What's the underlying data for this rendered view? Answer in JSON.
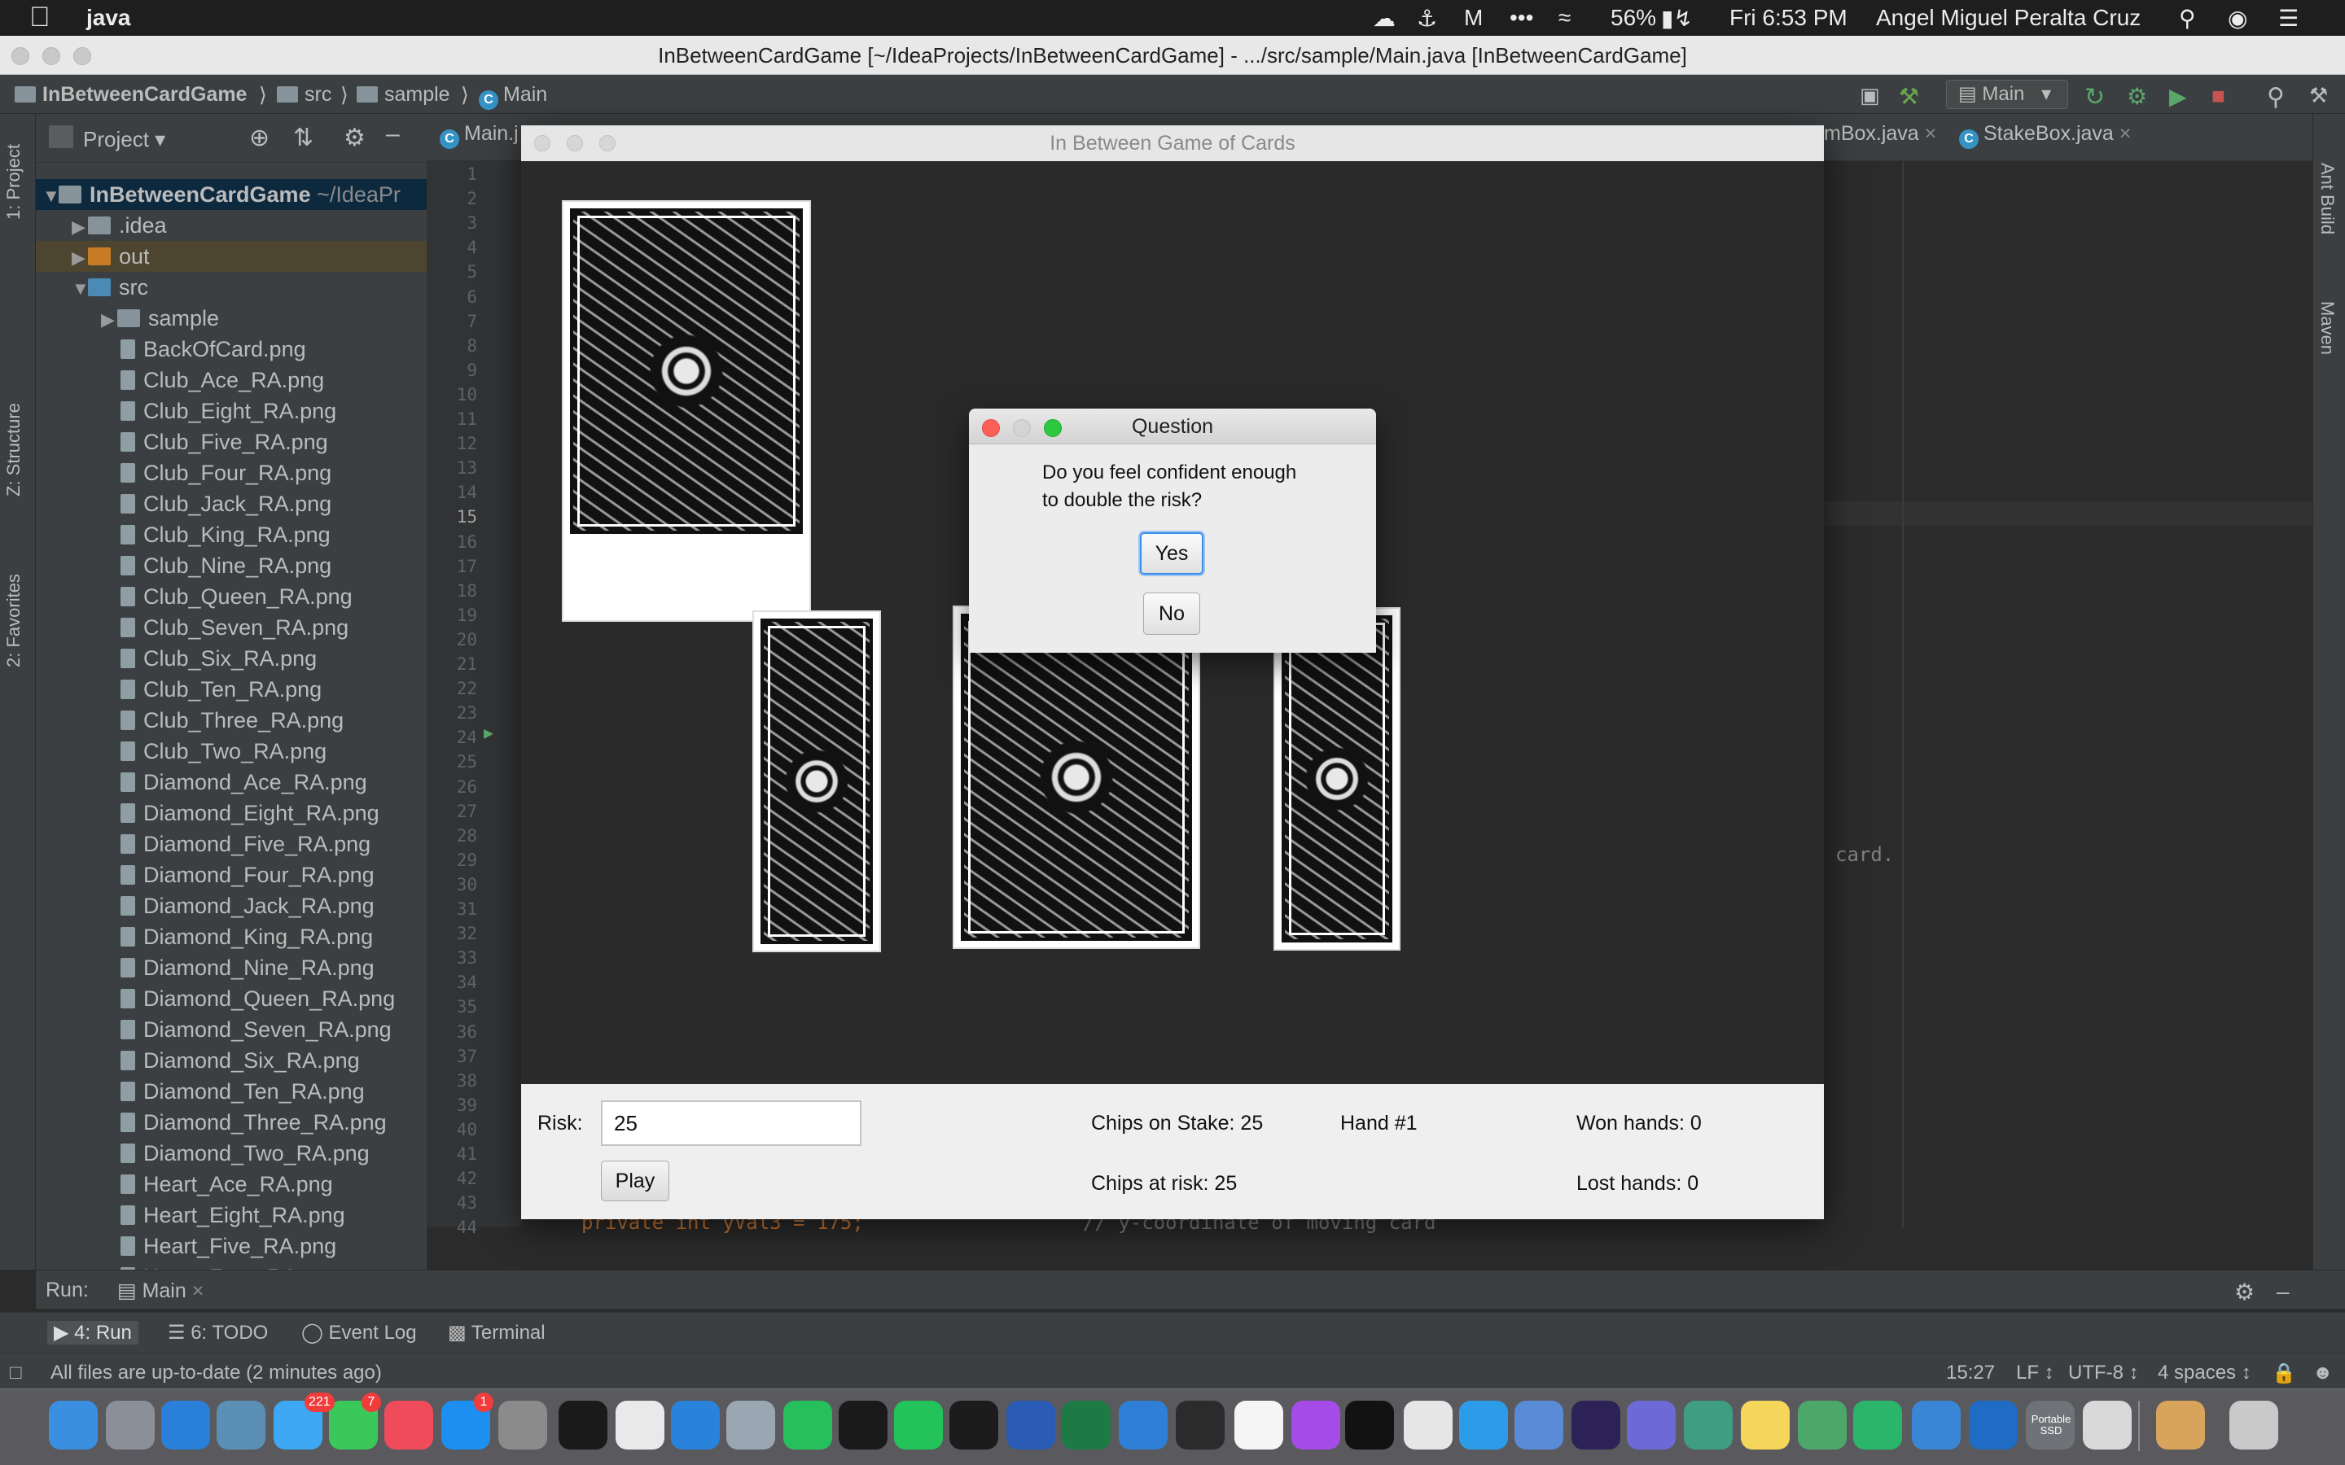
{
  "menubar": {
    "app_name": "java",
    "battery": "56%",
    "clock": "Fri 6:53 PM",
    "user": "Angel Miguel Peralta Cruz"
  },
  "window": {
    "title": "InBetweenCardGame [~/IdeaProjects/InBetweenCardGame] - .../src/sample/Main.java [InBetweenCardGame]"
  },
  "breadcrumb": {
    "project": "InBetweenCardGame",
    "src": "src",
    "package": "sample",
    "class": "Main",
    "run_config": "Main"
  },
  "sidebar": {
    "project_tab": "1: Project",
    "structure_tab": "Z: Structure",
    "favorites_tab": "2: Favorites",
    "ant_tab": "Ant Build",
    "maven_tab": "Maven"
  },
  "project_panel": {
    "title": "Project",
    "root": "InBetweenCardGame",
    "root_path": "~/IdeaPr",
    "folders": [
      ".idea",
      "out",
      "src",
      "sample"
    ],
    "files": [
      "BackOfCard.png",
      "Club_Ace_RA.png",
      "Club_Eight_RA.png",
      "Club_Five_RA.png",
      "Club_Four_RA.png",
      "Club_Jack_RA.png",
      "Club_King_RA.png",
      "Club_Nine_RA.png",
      "Club_Queen_RA.png",
      "Club_Seven_RA.png",
      "Club_Six_RA.png",
      "Club_Ten_RA.png",
      "Club_Three_RA.png",
      "Club_Two_RA.png",
      "Diamond_Ace_RA.png",
      "Diamond_Eight_RA.png",
      "Diamond_Five_RA.png",
      "Diamond_Four_RA.png",
      "Diamond_Jack_RA.png",
      "Diamond_King_RA.png",
      "Diamond_Nine_RA.png",
      "Diamond_Queen_RA.png",
      "Diamond_Seven_RA.png",
      "Diamond_Six_RA.png",
      "Diamond_Ten_RA.png",
      "Diamond_Three_RA.png",
      "Diamond_Two_RA.png",
      "Heart_Ace_RA.png",
      "Heart_Eight_RA.png",
      "Heart_Five_RA.png",
      "Heart_Four_RA.png"
    ]
  },
  "editor": {
    "tabs": [
      "Main.j",
      "mBox.java",
      "StakeBox.java"
    ],
    "line_numbers": [
      "1",
      "2",
      "3",
      "4",
      "5",
      "6",
      "7",
      "8",
      "9",
      "10",
      "11",
      "12",
      "13",
      "14",
      "15",
      "16",
      "17",
      "18",
      "19",
      "20",
      "21",
      "22",
      "23",
      "24",
      "25",
      "26",
      "27",
      "28",
      "29",
      "30",
      "31",
      "32",
      "33",
      "34",
      "35",
      "36",
      "37",
      "38",
      "39",
      "40",
      "41",
      "42",
      "43",
      "44"
    ],
    "code_fragment_1": "card.",
    "code_fragment_2": "private int yVal3 = 175;",
    "code_fragment_3": "// y-coordinate of moving card"
  },
  "game": {
    "title": "In Between Game of Cards",
    "risk_label": "Risk:",
    "risk_value": "25",
    "play_label": "Play",
    "chips_on_stake": "Chips on Stake: 25",
    "chips_at_risk": "Chips at risk: 25",
    "hand": "Hand #1",
    "won_hands": "Won hands: 0",
    "lost_hands": "Lost hands: 0"
  },
  "dialog": {
    "title": "Question",
    "line1": "Do you feel confident enough",
    "line2": "to double the risk?",
    "yes_label": "Yes",
    "no_label": "No"
  },
  "run_panel": {
    "label": "Run:",
    "tab": "Main"
  },
  "tool_buttons": {
    "run": "4: Run",
    "todo": "6: TODO",
    "event_log": "Event Log",
    "terminal": "Terminal"
  },
  "status": {
    "message": "All files are up-to-date (2 minutes ago)",
    "position": "15:27",
    "line_sep": "LF ↕",
    "encoding": "UTF-8 ↕",
    "indent": "4 spaces ↕"
  },
  "dock": {
    "mail_badge": "221",
    "facetime_badge": "7",
    "appstore_badge": "1",
    "drive_label": "Portable SSD"
  }
}
